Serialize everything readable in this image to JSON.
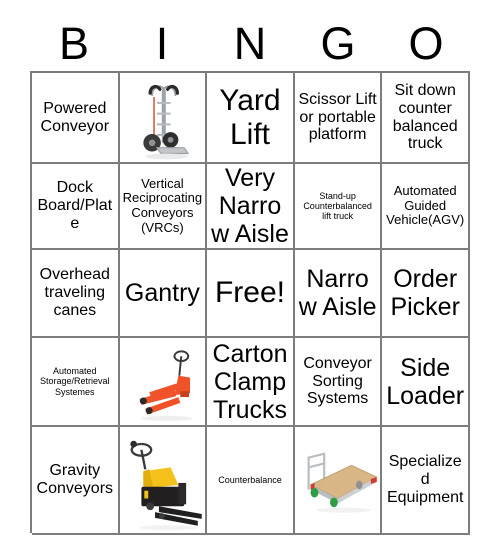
{
  "card": {
    "title": "BINGO",
    "header_letters": [
      "B",
      "I",
      "N",
      "G",
      "O"
    ],
    "colors": {
      "grid_line": "#7d7d7d",
      "background": "#ffffff",
      "text": "#000000",
      "hand_truck_metal": "#b9bcc0",
      "pallet_jack_orange": "#f0522a",
      "electric_truck_yellow": "#f5c21b",
      "electric_truck_black": "#211f1f",
      "platform_cart_deck": "#d8b685",
      "platform_cart_wheel": "#2f9e44"
    },
    "rows": [
      [
        {
          "kind": "text",
          "label": "Powered Conveyor",
          "size": "t-md",
          "name": "cell-powered-conveyor"
        },
        {
          "kind": "image",
          "label": "hand-truck-image",
          "size": "",
          "name": "cell-hand-truck"
        },
        {
          "kind": "text",
          "label": "Yard Lift",
          "size": "t-xl",
          "name": "cell-yard-lift"
        },
        {
          "kind": "text",
          "label": "Scissor Lift or portable platform",
          "size": "t-md",
          "name": "cell-scissor-lift"
        },
        {
          "kind": "text",
          "label": "Sit down counter balanced truck",
          "size": "t-md",
          "name": "cell-sit-down-counter-balanced-truck"
        }
      ],
      [
        {
          "kind": "text",
          "label": "Dock Board/Plate",
          "size": "t-md",
          "name": "cell-dock-board-plate"
        },
        {
          "kind": "text",
          "label": "Vertical Reciprocating Conveyors (VRCs)",
          "size": "t-sm",
          "name": "cell-vertical-reciprocating-conveyors"
        },
        {
          "kind": "text",
          "label": "Very Narrow Aisle",
          "size": "t-lg",
          "name": "cell-very-narrow-aisle"
        },
        {
          "kind": "text",
          "label": "Stand-up Counterbalanced lift truck",
          "size": "t-xs",
          "name": "cell-stand-up-counterbalanced-lift-truck"
        },
        {
          "kind": "text",
          "label": "Automated Guided Vehicle(AGV)",
          "size": "t-sm",
          "name": "cell-automated-guided-vehicle"
        }
      ],
      [
        {
          "kind": "text",
          "label": "Overhead traveling canes",
          "size": "t-md",
          "name": "cell-overhead-traveling-canes"
        },
        {
          "kind": "text",
          "label": "Gantry",
          "size": "t-lg",
          "name": "cell-gantry"
        },
        {
          "kind": "text",
          "label": "Free!",
          "size": "t-xl",
          "name": "cell-free-space"
        },
        {
          "kind": "text",
          "label": "Narrow Aisle",
          "size": "t-lg",
          "name": "cell-narrow-aisle"
        },
        {
          "kind": "text",
          "label": "Order Picker",
          "size": "t-lg",
          "name": "cell-order-picker"
        }
      ],
      [
        {
          "kind": "text",
          "label": "Automated Storage/Retrieval Systemes",
          "size": "t-xs",
          "name": "cell-automated-storage-retrieval-systemes"
        },
        {
          "kind": "image",
          "label": "pallet-jack-image",
          "size": "",
          "name": "cell-pallet-jack"
        },
        {
          "kind": "text",
          "label": "Carton Clamp Trucks",
          "size": "t-lg",
          "name": "cell-carton-clamp-trucks"
        },
        {
          "kind": "text",
          "label": "Conveyor Sorting Systems",
          "size": "t-md",
          "name": "cell-conveyor-sorting-systems"
        },
        {
          "kind": "text",
          "label": "Side Loader",
          "size": "t-lg",
          "name": "cell-side-loader"
        }
      ],
      [
        {
          "kind": "text",
          "label": "Gravity Conveyors",
          "size": "t-md",
          "name": "cell-gravity-conveyors"
        },
        {
          "kind": "image",
          "label": "electric-pallet-truck-image",
          "size": "",
          "name": "cell-electric-pallet-truck"
        },
        {
          "kind": "text",
          "label": "Counterbalance",
          "size": "t-xs",
          "name": "cell-counterbalance"
        },
        {
          "kind": "image",
          "label": "platform-cart-image",
          "size": "",
          "name": "cell-platform-cart"
        },
        {
          "kind": "text",
          "label": "Specialized Equipment",
          "size": "t-md",
          "name": "cell-specialized-equipment"
        }
      ]
    ]
  }
}
